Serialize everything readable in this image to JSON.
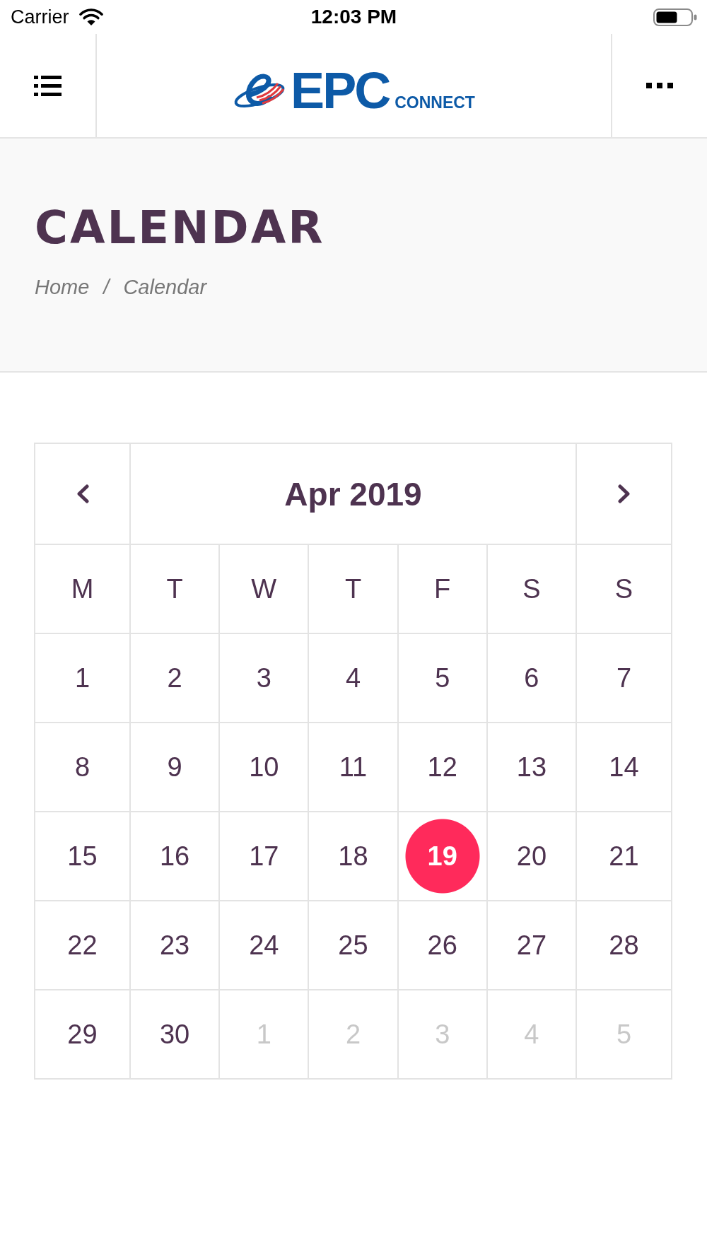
{
  "status_bar": {
    "carrier": "Carrier",
    "time": "12:03 PM"
  },
  "nav_bar": {
    "logo": {
      "wordmark": "EPC",
      "tagline": "CONNECT"
    }
  },
  "page_header": {
    "title": "CALENDAR",
    "breadcrumb": [
      "Home",
      "Calendar"
    ],
    "separator": "/"
  },
  "calendar": {
    "month": "Apr 2019",
    "weekdays": [
      "M",
      "T",
      "W",
      "T",
      "F",
      "S",
      "S"
    ],
    "weeks": [
      {
        "days": [
          {
            "day": "1",
            "outside_month": false,
            "selected": false
          },
          {
            "day": "2",
            "outside_month": false,
            "selected": false
          },
          {
            "day": "3",
            "outside_month": false,
            "selected": false
          },
          {
            "day": "4",
            "outside_month": false,
            "selected": false
          },
          {
            "day": "5",
            "outside_month": false,
            "selected": false
          },
          {
            "day": "6",
            "outside_month": false,
            "selected": false
          },
          {
            "day": "7",
            "outside_month": false,
            "selected": false
          }
        ]
      },
      {
        "days": [
          {
            "day": "8",
            "outside_month": false,
            "selected": false
          },
          {
            "day": "9",
            "outside_month": false,
            "selected": false
          },
          {
            "day": "10",
            "outside_month": false,
            "selected": false
          },
          {
            "day": "11",
            "outside_month": false,
            "selected": false
          },
          {
            "day": "12",
            "outside_month": false,
            "selected": false
          },
          {
            "day": "13",
            "outside_month": false,
            "selected": false
          },
          {
            "day": "14",
            "outside_month": false,
            "selected": false
          }
        ]
      },
      {
        "days": [
          {
            "day": "15",
            "outside_month": false,
            "selected": false
          },
          {
            "day": "16",
            "outside_month": false,
            "selected": false
          },
          {
            "day": "17",
            "outside_month": false,
            "selected": false
          },
          {
            "day": "18",
            "outside_month": false,
            "selected": false
          },
          {
            "day": "19",
            "outside_month": false,
            "selected": true
          },
          {
            "day": "20",
            "outside_month": false,
            "selected": false
          },
          {
            "day": "21",
            "outside_month": false,
            "selected": false
          }
        ]
      },
      {
        "days": [
          {
            "day": "22",
            "outside_month": false,
            "selected": false
          },
          {
            "day": "23",
            "outside_month": false,
            "selected": false
          },
          {
            "day": "24",
            "outside_month": false,
            "selected": false
          },
          {
            "day": "25",
            "outside_month": false,
            "selected": false
          },
          {
            "day": "26",
            "outside_month": false,
            "selected": false
          },
          {
            "day": "27",
            "outside_month": false,
            "selected": false
          },
          {
            "day": "28",
            "outside_month": false,
            "selected": false
          }
        ]
      },
      {
        "days": [
          {
            "day": "29",
            "outside_month": false,
            "selected": false
          },
          {
            "day": "30",
            "outside_month": false,
            "selected": false
          },
          {
            "day": "1",
            "outside_month": true,
            "selected": false
          },
          {
            "day": "2",
            "outside_month": true,
            "selected": false
          },
          {
            "day": "3",
            "outside_month": true,
            "selected": false
          },
          {
            "day": "4",
            "outside_month": true,
            "selected": false
          },
          {
            "day": "5",
            "outside_month": true,
            "selected": false
          }
        ]
      }
    ]
  }
}
